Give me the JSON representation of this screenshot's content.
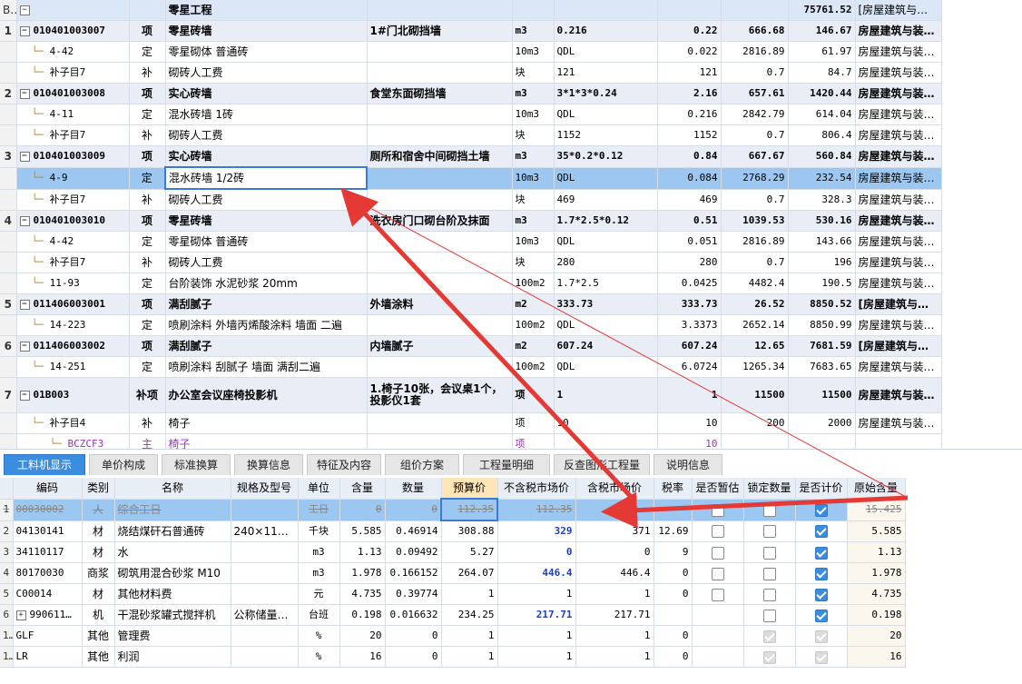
{
  "top": {
    "header": {
      "no": "B1",
      "code": "",
      "type": "",
      "name": "零星工程",
      "feature": "",
      "unit": "",
      "expr": "",
      "qty": "",
      "price": "",
      "total": "75761.52",
      "specialty": "[房屋建筑与…"
    },
    "rows": [
      {
        "kind": "sec",
        "no": "1",
        "code": "010401003007",
        "type": "项",
        "name": "零星砖墙",
        "feature": "1#门北砌挡墙",
        "unit": "m3",
        "expr": "0.216",
        "qty": "0.22",
        "price": "666.68",
        "total": "146.67",
        "specialty": "房屋建筑与装…"
      },
      {
        "kind": "sub",
        "no": "",
        "code": "4-42",
        "type": "定",
        "name": "零星砌体 普通砖",
        "feature": "",
        "unit": "10m3",
        "expr": "QDL",
        "qty": "0.022",
        "price": "2816.89",
        "total": "61.97",
        "specialty": "房屋建筑与装…"
      },
      {
        "kind": "sub",
        "no": "",
        "code": "补子目7",
        "type": "补",
        "name": "砌砖人工费",
        "feature": "",
        "unit": "块",
        "expr": "121",
        "qty": "121",
        "price": "0.7",
        "total": "84.7",
        "specialty": "房屋建筑与装…"
      },
      {
        "kind": "sec",
        "no": "2",
        "code": "010401003008",
        "type": "项",
        "name": "实心砖墙",
        "feature": "食堂东面砌挡墙",
        "unit": "m3",
        "expr": "3*1*3*0.24",
        "qty": "2.16",
        "price": "657.61",
        "total": "1420.44",
        "specialty": "房屋建筑与装…"
      },
      {
        "kind": "sub",
        "no": "",
        "code": "4-11",
        "type": "定",
        "name": "混水砖墙 1砖",
        "feature": "",
        "unit": "10m3",
        "expr": "QDL",
        "qty": "0.216",
        "price": "2842.79",
        "total": "614.04",
        "specialty": "房屋建筑与装…"
      },
      {
        "kind": "sub",
        "no": "",
        "code": "补子目7",
        "type": "补",
        "name": "砌砖人工费",
        "feature": "",
        "unit": "块",
        "expr": "1152",
        "qty": "1152",
        "price": "0.7",
        "total": "806.4",
        "specialty": "房屋建筑与装…"
      },
      {
        "kind": "sec",
        "no": "3",
        "code": "010401003009",
        "type": "项",
        "name": "实心砖墙",
        "feature": "厕所和宿舍中间砌挡土墙",
        "unit": "m3",
        "expr": "35*0.2*0.12",
        "qty": "0.84",
        "price": "667.67",
        "total": "560.84",
        "specialty": "房屋建筑与装…"
      },
      {
        "kind": "sel",
        "no": "",
        "code": "4-9",
        "type": "定",
        "name": "混水砖墙 1/2砖",
        "feature": "",
        "unit": "10m3",
        "expr": "QDL",
        "qty": "0.084",
        "price": "2768.29",
        "total": "232.54",
        "specialty": "房屋建筑与装…"
      },
      {
        "kind": "sub",
        "no": "",
        "code": "补子目7",
        "type": "补",
        "name": "砌砖人工费",
        "feature": "",
        "unit": "块",
        "expr": "469",
        "qty": "469",
        "price": "0.7",
        "total": "328.3",
        "specialty": "房屋建筑与装…"
      },
      {
        "kind": "sec",
        "no": "4",
        "code": "010401003010",
        "type": "项",
        "name": "零星砖墙",
        "feature": "洗衣房门口砌台阶及抹面",
        "unit": "m3",
        "expr": "1.7*2.5*0.12",
        "qty": "0.51",
        "price": "1039.53",
        "total": "530.16",
        "specialty": "房屋建筑与装…"
      },
      {
        "kind": "sub",
        "no": "",
        "code": "4-42",
        "type": "定",
        "name": "零星砌体 普通砖",
        "feature": "",
        "unit": "10m3",
        "expr": "QDL",
        "qty": "0.051",
        "price": "2816.89",
        "total": "143.66",
        "specialty": "房屋建筑与装…"
      },
      {
        "kind": "sub",
        "no": "",
        "code": "补子目7",
        "type": "补",
        "name": "砌砖人工费",
        "feature": "",
        "unit": "块",
        "expr": "280",
        "qty": "280",
        "price": "0.7",
        "total": "196",
        "specialty": "房屋建筑与装…"
      },
      {
        "kind": "sub",
        "no": "",
        "code": "11-93",
        "type": "定",
        "name": "台阶装饰 水泥砂浆 20mm",
        "feature": "",
        "unit": "100m2",
        "expr": "1.7*2.5",
        "qty": "0.0425",
        "price": "4482.4",
        "total": "190.5",
        "specialty": "房屋建筑与装…"
      },
      {
        "kind": "sec",
        "no": "5",
        "code": "011406003001",
        "type": "项",
        "name": "满刮腻子",
        "feature": "外墙涂料",
        "unit": "m2",
        "expr": "333.73",
        "qty": "333.73",
        "price": "26.52",
        "total": "8850.52",
        "specialty": "[房屋建筑与装…"
      },
      {
        "kind": "sub",
        "no": "",
        "code": "14-223",
        "type": "定",
        "name": "喷刷涂料 外墙丙烯酸涂料 墙面 二遍",
        "feature": "",
        "unit": "100m2",
        "expr": "QDL",
        "qty": "3.3373",
        "price": "2652.14",
        "total": "8850.99",
        "specialty": "房屋建筑与装…"
      },
      {
        "kind": "sec",
        "no": "6",
        "code": "011406003002",
        "type": "项",
        "name": "满刮腻子",
        "feature": "内墙腻子",
        "unit": "m2",
        "expr": "607.24",
        "qty": "607.24",
        "price": "12.65",
        "total": "7681.59",
        "specialty": "[房屋建筑与装…"
      },
      {
        "kind": "sub",
        "no": "",
        "code": "14-251",
        "type": "定",
        "name": "喷刷涂料 刮腻子 墙面 满刮二遍",
        "feature": "",
        "unit": "100m2",
        "expr": "QDL",
        "qty": "6.0724",
        "price": "1265.34",
        "total": "7683.65",
        "specialty": "房屋建筑与装…"
      },
      {
        "kind": "sec",
        "no": "7",
        "code": "01B003",
        "type": "补项",
        "name": "办公室会议座椅投影机",
        "feature": "1.椅子10张，会议桌1个，投影仪1套",
        "unit": "项",
        "expr": "1",
        "qty": "1",
        "price": "11500",
        "total": "11500",
        "specialty": "房屋建筑与装饰工程"
      },
      {
        "kind": "sub",
        "no": "",
        "code": "补子目4",
        "type": "补",
        "name": "椅子",
        "feature": "",
        "unit": "项",
        "expr": "10",
        "qty": "10",
        "price": "200",
        "total": "2000",
        "specialty": "房屋建筑与装…"
      },
      {
        "kind": "mat",
        "no": "",
        "code": "BCZCF3",
        "type": "主",
        "name": "椅子",
        "feature": "",
        "unit": "项",
        "expr": "",
        "qty": "10",
        "price": "",
        "total": "",
        "specialty": ""
      }
    ]
  },
  "tabs": [
    "工料机显示",
    "单价构成",
    "标准换算",
    "换算信息",
    "特征及内容",
    "组价方案",
    "工程量明细",
    "反查图形工程量",
    "说明信息"
  ],
  "bottom": {
    "headers": [
      "",
      "编码",
      "类别",
      "名称",
      "规格及型号",
      "单位",
      "含量",
      "数量",
      "预算价",
      "不含税市场价",
      "含税市场价",
      "税率",
      "是否暂估",
      "锁定数量",
      "是否计价",
      "原始含量"
    ],
    "rows": [
      {
        "no": "1",
        "code": "00030002",
        "cat": "人",
        "name": "综合工日",
        "spec": "",
        "unit": "工日",
        "content": "0",
        "qty": "0",
        "budget": "112.35",
        "nontax": "112.35",
        "tax": "",
        "rate": "",
        "est": false,
        "lock": false,
        "priced": true,
        "orig": "15.425",
        "del": true
      },
      {
        "no": "2",
        "code": "04130141",
        "cat": "材",
        "name": "烧结煤矸石普通砖",
        "spec": "240×115…",
        "unit": "千块",
        "content": "5.585",
        "qty": "0.46914",
        "budget": "308.88",
        "nontax": "329",
        "tax": "371",
        "rate": "12.69",
        "est": false,
        "lock": false,
        "priced": true,
        "orig": "5.585",
        "blue": true
      },
      {
        "no": "3",
        "code": "34110117",
        "cat": "材",
        "name": "水",
        "spec": "",
        "unit": "m3",
        "content": "1.13",
        "qty": "0.09492",
        "budget": "5.27",
        "nontax": "0",
        "tax": "0",
        "rate": "9",
        "est": false,
        "lock": false,
        "priced": true,
        "orig": "1.13",
        "blue": true
      },
      {
        "no": "4",
        "code": "80170030",
        "cat": "商浆",
        "name": "砌筑用混合砂浆 M10",
        "spec": "",
        "unit": "m3",
        "content": "1.978",
        "qty": "0.166152",
        "budget": "264.07",
        "nontax": "446.4",
        "tax": "446.4",
        "rate": "0",
        "est": false,
        "lock": false,
        "priced": true,
        "orig": "1.978",
        "blue": true
      },
      {
        "no": "5",
        "code": "C00014",
        "cat": "材",
        "name": "其他材料费",
        "spec": "",
        "unit": "元",
        "content": "4.735",
        "qty": "0.39774",
        "budget": "1",
        "nontax": "1",
        "tax": "1",
        "rate": "0",
        "est": false,
        "lock": false,
        "priced": true,
        "orig": "4.735"
      },
      {
        "no": "6",
        "code": "990611…",
        "cat": "机",
        "name": "干混砂浆罐式搅拌机",
        "spec": "公称储量2…",
        "unit": "台班",
        "content": "0.198",
        "qty": "0.016632",
        "budget": "234.25",
        "nontax": "217.71",
        "tax": "217.71",
        "rate": "",
        "est": null,
        "lock": false,
        "priced": true,
        "orig": "0.198",
        "blue": true,
        "expand": true
      },
      {
        "no": "13",
        "code": "GLF",
        "cat": "其他",
        "name": "管理费",
        "spec": "",
        "unit": "%",
        "content": "20",
        "qty": "0",
        "budget": "1",
        "nontax": "1",
        "tax": "1",
        "rate": "0",
        "est": null,
        "lock": "dis",
        "priced": "dis",
        "orig": "20"
      },
      {
        "no": "14",
        "code": "LR",
        "cat": "其他",
        "name": "利润",
        "spec": "",
        "unit": "%",
        "content": "16",
        "qty": "0",
        "budget": "1",
        "nontax": "1",
        "tax": "1",
        "rate": "0",
        "est": null,
        "lock": "dis",
        "priced": "dis",
        "orig": "16"
      }
    ]
  },
  "colors": {
    "accent": "#3b8de0",
    "selected_row": "#9cc7f0",
    "section_row": "#e9eef6",
    "arrow": "#e53935",
    "blue_value": "#1c3fc4"
  }
}
